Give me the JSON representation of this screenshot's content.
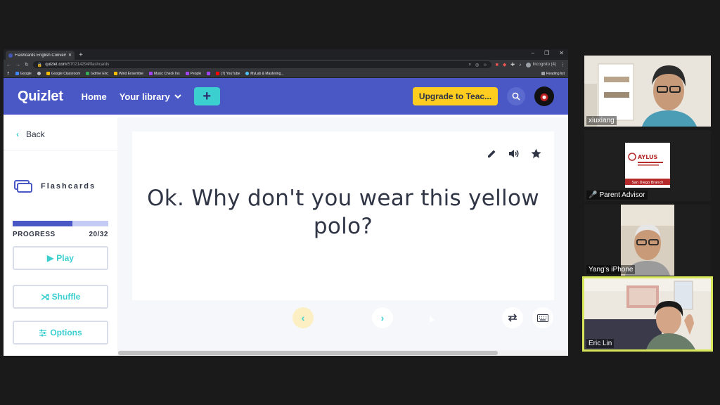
{
  "browser": {
    "tab_title": "Flashcards English Conversation",
    "url_host": "quizlet.com",
    "url_path": "/570214294/flashcards",
    "incognito": "Incognito (4)",
    "bookmarks": [
      "Google",
      "Google Classroom",
      "Gdrive Eric",
      "Wind Ensemble",
      "Music Check Ins",
      "People",
      "(7) YouTube",
      "MyLab & Mastering..."
    ],
    "reading_list": "Reading list"
  },
  "header": {
    "logo": "Quizlet",
    "home": "Home",
    "library": "Your library",
    "upgrade": "Upgrade to Teac..."
  },
  "sidebar": {
    "back": "Back",
    "mode": "Flashcards",
    "progress_label": "PROGRESS",
    "progress_count": "20/32",
    "progress_fraction": 0.625,
    "play": "Play",
    "shuffle": "Shuffle",
    "options": "Options"
  },
  "card": {
    "text": "Ok. Why don't you wear this yellow polo?"
  },
  "participants": [
    {
      "name": "xiuxiang"
    },
    {
      "name": "Parent Advisor"
    },
    {
      "name": "Yang's iPhone"
    },
    {
      "name": "Eric Lin"
    }
  ],
  "advisor_slide": {
    "title": "AYLUS",
    "branch": "San Diego Branch"
  },
  "colors": {
    "quizlet_blue": "#4a58c6",
    "teal": "#3ccfcf",
    "yellow": "#ffcd1f",
    "active_speaker": "#d9e85a"
  }
}
